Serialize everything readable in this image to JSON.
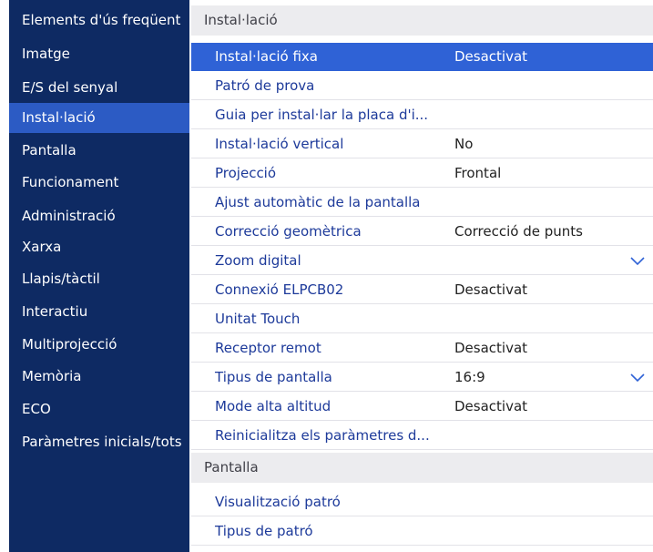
{
  "sidebar": {
    "items": [
      {
        "label": "Elements d'ús freqüent",
        "active": false
      },
      {
        "label": "Imatge",
        "active": false
      },
      {
        "label": "E/S del senyal",
        "active": false
      },
      {
        "label": "Instal·lació",
        "active": true
      },
      {
        "label": "Pantalla",
        "active": false
      },
      {
        "label": "Funcionament",
        "active": false
      },
      {
        "label": "Administració",
        "active": false
      },
      {
        "label": "Xarxa",
        "active": false
      },
      {
        "label": "Llapis/tàctil",
        "active": false
      },
      {
        "label": "Interactiu",
        "active": false
      },
      {
        "label": "Multiprojecció",
        "active": false
      },
      {
        "label": "Memòria",
        "active": false
      },
      {
        "label": "ECO",
        "active": false
      },
      {
        "label": "Paràmetres inicials/tots",
        "active": false
      }
    ]
  },
  "main": {
    "section1": {
      "title": "Instal·lació",
      "rows": [
        {
          "label": "Instal·lació fixa",
          "value": "Desactivat",
          "selected": true
        },
        {
          "label": "Patró de prova",
          "value": ""
        },
        {
          "label": "Guia per instal·lar la placa d'i...",
          "value": ""
        },
        {
          "label": "Instal·lació vertical",
          "value": "No"
        },
        {
          "label": "Projecció",
          "value": "Frontal"
        },
        {
          "label": "Ajust automàtic de la pantalla",
          "value": ""
        },
        {
          "label": "Correcció geomètrica",
          "value": "Correcció de punts"
        },
        {
          "label": "Zoom digital",
          "value": "",
          "expand_icon": "chevron-down-icon"
        },
        {
          "label": "Connexió ELPCB02",
          "value": "Desactivat"
        },
        {
          "label": "Unitat Touch",
          "value": ""
        },
        {
          "label": "Receptor remot",
          "value": "Desactivat"
        },
        {
          "label": "Tipus de pantalla",
          "value": "16:9",
          "expand_icon": "chevron-down-icon"
        },
        {
          "label": "Mode alta altitud",
          "value": "Desactivat"
        },
        {
          "label": "Reinicialitza els paràmetres d...",
          "value": ""
        }
      ]
    },
    "section2": {
      "title": "Pantalla",
      "rows": [
        {
          "label": "Visualització patró",
          "value": ""
        },
        {
          "label": "Tipus de patró",
          "value": ""
        }
      ]
    }
  },
  "colors": {
    "sidebar_bg": "#0e2a63",
    "sidebar_active": "#2c5bc4",
    "row_highlight": "#2f62d6",
    "label_text": "#1d3a9a",
    "section_header_bg": "#ececef"
  }
}
